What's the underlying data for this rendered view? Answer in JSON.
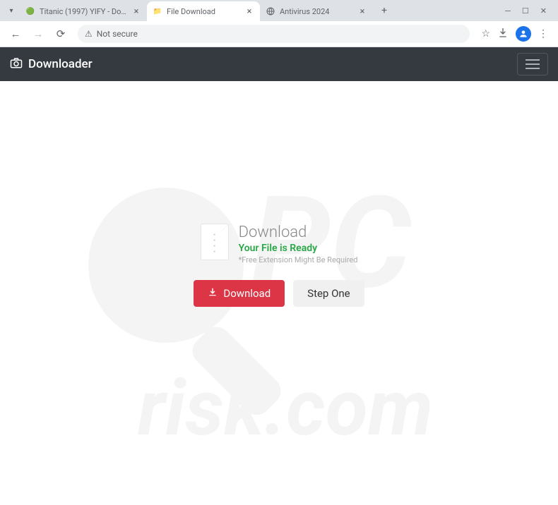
{
  "browser": {
    "tabs": [
      {
        "title": "Titanic (1997) YIFY - Download",
        "active": false
      },
      {
        "title": "File Download",
        "active": true
      },
      {
        "title": "Antivirus 2024",
        "active": false
      }
    ],
    "address": {
      "security_label": "Not secure"
    }
  },
  "header": {
    "brand": "Downloader"
  },
  "card": {
    "title": "Download",
    "subtitle": "Your File is Ready",
    "note": "*Free Extension Might Be Required"
  },
  "buttons": {
    "download_label": "Download",
    "step_label": "Step One"
  },
  "colors": {
    "header_bg": "#343a40",
    "download_btn": "#dc3545",
    "ready_text": "#28a745"
  }
}
